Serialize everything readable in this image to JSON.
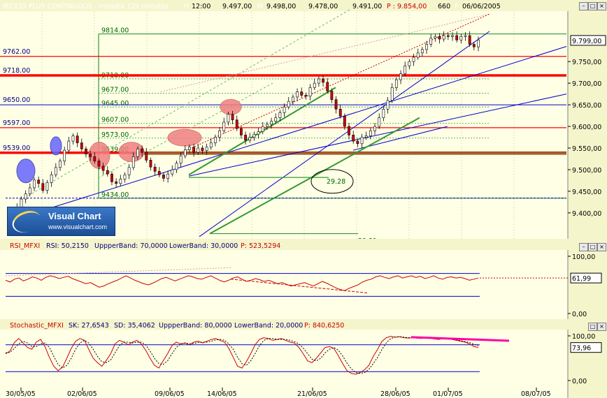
{
  "header": {
    "symbol": "IBEX35 PLUS CONTINUOUS - Intradia 120 minutos",
    "h_label": "H",
    "time": "12:00",
    "open": "9.497,00",
    "m_label": "M",
    "high": "9.498,00",
    "low": "9.478,00",
    "close": "9.491,00",
    "p_label": "P : 9.854,00",
    "volume": "660",
    "date": "06/06/2005",
    "f_label": "F"
  },
  "colors": {
    "background": "#FFFFE6",
    "candle_up": "#FFFFFF",
    "candle_down": "#CC0000",
    "support_red": "#FF0000",
    "level_blue": "#0000CC",
    "trend_green": "#339933",
    "oscillator": "#CC0000",
    "ellipse_fill": "#F08080",
    "ellipse_blue": "#6666FF",
    "brown_band": "#996633"
  },
  "logo": {
    "name": "Visual Chart",
    "url": "www.visualchart.com"
  },
  "chart_data": [
    {
      "type": "candlestick",
      "title": "IBEX35 PLUS CONTINUOUS - Intradia 120 minutos",
      "price_axis_ticks": [
        "9.750,00",
        "9.700,00",
        "9.650,00",
        "9.600,00",
        "9.550,00",
        "9.500,00",
        "9.450,00",
        "9.400,00"
      ],
      "price_axis_values": [
        9750,
        9700,
        9650,
        9600,
        9550,
        9500,
        9450,
        9400
      ],
      "ylim": [
        9340,
        9865
      ],
      "last_price_label": "9.799,00",
      "last_price": 9799,
      "date_ticks": [
        "30/05/05",
        "02/06/05",
        "09/06/05",
        "14/06/05",
        "21/06/05",
        "28/06/05",
        "01/07/05",
        "08/07/05"
      ],
      "left_levels": [
        {
          "label": "9762.00",
          "value": 9762,
          "color": "red"
        },
        {
          "label": "9718.00",
          "value": 9718,
          "color": "red-thick"
        },
        {
          "label": "9650.00",
          "value": 9650,
          "color": "blue"
        },
        {
          "label": "9597.00",
          "value": 9597,
          "color": "red"
        },
        {
          "label": "9539.00",
          "value": 9539,
          "color": "red-thick"
        }
      ],
      "fib_levels": [
        {
          "label": "9814.00",
          "value": 9814
        },
        {
          "label": "9710.00",
          "value": 9710
        },
        {
          "label": "9677.00",
          "value": 9677
        },
        {
          "label": "9645.00",
          "value": 9645
        },
        {
          "label": "9607.00",
          "value": 9607
        },
        {
          "label": "9573.00",
          "value": 9573
        },
        {
          "label": "9539.00",
          "value": 9539
        },
        {
          "label": "9434.00",
          "value": 9434
        }
      ],
      "annotations": [
        {
          "label": "29.28",
          "value": 9468
        },
        {
          "label": "29.31",
          "value": 9350
        }
      ],
      "closes": [
        9382,
        9396,
        9412,
        9432,
        9444,
        9458,
        9476,
        9468,
        9452,
        9470,
        9488,
        9505,
        9520,
        9545,
        9566,
        9578,
        9562,
        9548,
        9536,
        9530,
        9520,
        9508,
        9498,
        9490,
        9472,
        9468,
        9478,
        9488,
        9505,
        9530,
        9548,
        9540,
        9522,
        9506,
        9496,
        9488,
        9480,
        9490,
        9500,
        9515,
        9532,
        9546,
        9552,
        9540,
        9550,
        9544,
        9552,
        9562,
        9575,
        9590,
        9610,
        9628,
        9615,
        9595,
        9580,
        9568,
        9575,
        9582,
        9588,
        9600,
        9605,
        9612,
        9620,
        9632,
        9645,
        9658,
        9668,
        9680,
        9672,
        9670,
        9690,
        9700,
        9710,
        9702,
        9682,
        9662,
        9640,
        9624,
        9600,
        9580,
        9566,
        9560,
        9575,
        9578,
        9590,
        9600,
        9620,
        9640,
        9660,
        9690,
        9708,
        9722,
        9740,
        9750,
        9760,
        9770,
        9778,
        9790,
        9804,
        9808,
        9802,
        9810,
        9808,
        9810,
        9800,
        9808,
        9810,
        9790,
        9784,
        9800
      ]
    },
    {
      "type": "line",
      "title": "RSI_MFXI",
      "header_items": [
        "RSI_MFXI",
        "RSI: 50,2150",
        "UppperBand: 70,0000",
        "LowerBand: 30,0000",
        "P: 523,5294"
      ],
      "ticks": [
        "100,00",
        "0,00"
      ],
      "tick_values": [
        100,
        0
      ],
      "ylim": [
        0,
        100
      ],
      "upper_band": 70,
      "lower_band": 30,
      "last_value_label": "61,99",
      "last_value": 61.99,
      "values": [
        58,
        55,
        60,
        62,
        57,
        60,
        64,
        62,
        58,
        63,
        66,
        64,
        61,
        63,
        65,
        61,
        58,
        55,
        52,
        54,
        50,
        46,
        48,
        52,
        55,
        58,
        62,
        66,
        62,
        58,
        55,
        52,
        50,
        53,
        57,
        61,
        63,
        60,
        57,
        60,
        63,
        66,
        64,
        61,
        60,
        63,
        66,
        62,
        58,
        55,
        58,
        62,
        64,
        60,
        56,
        58,
        61,
        59,
        56,
        58,
        55,
        52,
        54,
        51,
        48,
        50,
        52,
        54,
        51,
        48,
        52,
        56,
        53,
        49,
        45,
        42,
        40,
        44,
        47,
        50,
        55,
        58,
        60,
        64,
        66,
        63,
        61,
        64,
        66,
        62,
        64,
        66,
        63,
        65,
        61,
        63,
        66,
        62,
        60,
        63,
        64,
        62,
        63,
        61,
        58,
        60,
        62
      ]
    },
    {
      "type": "line",
      "title": "Stochastic_MFXI",
      "header_items": [
        "Stochastic_MFXI",
        "SK: 27,6543",
        "SD: 35,4062",
        "UppperBand: 80,0000",
        "LowerBand: 20,0000",
        "P: 840,6250"
      ],
      "ticks": [
        "100,00",
        "0,00"
      ],
      "tick_values": [
        100,
        0
      ],
      "ylim": [
        0,
        100
      ],
      "upper_band": 80,
      "lower_band": 20,
      "last_value_label": "73,96",
      "last_value": 73.96,
      "series": [
        {
          "name": "SK",
          "values": [
            60,
            66,
            85,
            94,
            84,
            74,
            70,
            86,
            92,
            76,
            52,
            32,
            22,
            30,
            50,
            72,
            88,
            94,
            90,
            70,
            50,
            40,
            32,
            45,
            60,
            82,
            90,
            86,
            80,
            86,
            90,
            82,
            68,
            50,
            34,
            28,
            44,
            60,
            78,
            86,
            82,
            84,
            80,
            86,
            88,
            84,
            88,
            92,
            94,
            90,
            86,
            72,
            52,
            32,
            28,
            42,
            60,
            80,
            92,
            96,
            94,
            90,
            92,
            94,
            90,
            86,
            84,
            74,
            60,
            44,
            40,
            50,
            62,
            74,
            76,
            72,
            56,
            38,
            22,
            16,
            14,
            18,
            24,
            34,
            54,
            70,
            88,
            96,
            99,
            97,
            98,
            96,
            95,
            96,
            95,
            94,
            96,
            95,
            93,
            92,
            94,
            93,
            92,
            90,
            88,
            86,
            82,
            76,
            74
          ]
        },
        {
          "name": "SD",
          "values": [
            62,
            63,
            72,
            82,
            88,
            84,
            76,
            76,
            82,
            84,
            74,
            54,
            36,
            28,
            34,
            50,
            70,
            84,
            90,
            84,
            70,
            54,
            42,
            40,
            46,
            62,
            78,
            86,
            86,
            84,
            86,
            86,
            80,
            66,
            50,
            38,
            36,
            44,
            60,
            74,
            82,
            84,
            82,
            83,
            85,
            86,
            86,
            88,
            91,
            92,
            90,
            82,
            70,
            52,
            38,
            34,
            44,
            60,
            78,
            90,
            94,
            94,
            92,
            92,
            92,
            90,
            87,
            82,
            73,
            60,
            48,
            44,
            50,
            62,
            70,
            74,
            68,
            55,
            39,
            26,
            18,
            16,
            18,
            25,
            38,
            52,
            70,
            85,
            94,
            97,
            98,
            97,
            96,
            96,
            95,
            95,
            95,
            95,
            94,
            93,
            93,
            93,
            92,
            91,
            89,
            87,
            85,
            81,
            78
          ]
        }
      ]
    }
  ]
}
